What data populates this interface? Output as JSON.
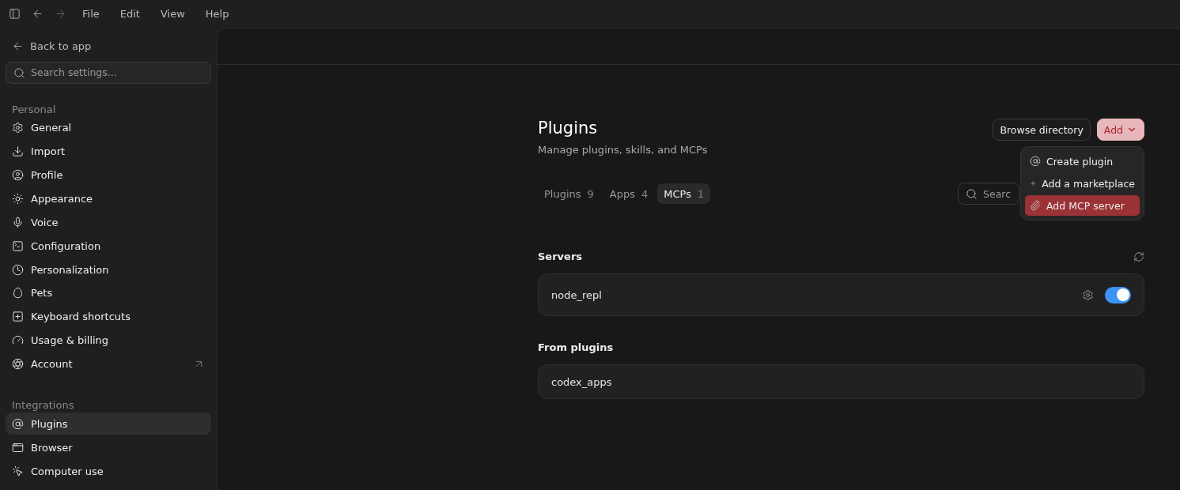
{
  "menu_bar": {
    "items": [
      "File",
      "Edit",
      "View",
      "Help"
    ]
  },
  "sidebar": {
    "back": "Back to app",
    "search": {
      "placeholder": "Search settings..."
    },
    "sections": [
      {
        "title": "Personal",
        "items": [
          {
            "label": "General",
            "selected": false,
            "external": false
          },
          {
            "label": "Import",
            "selected": false,
            "external": false
          },
          {
            "label": "Profile",
            "selected": false,
            "external": false
          },
          {
            "label": "Appearance",
            "selected": false,
            "external": false
          },
          {
            "label": "Voice",
            "selected": false,
            "external": false
          },
          {
            "label": "Configuration",
            "selected": false,
            "external": false
          },
          {
            "label": "Personalization",
            "selected": false,
            "external": false
          },
          {
            "label": "Pets",
            "selected": false,
            "external": false
          },
          {
            "label": "Keyboard shortcuts",
            "selected": false,
            "external": false
          },
          {
            "label": "Usage & billing",
            "selected": false,
            "external": false
          },
          {
            "label": "Account",
            "selected": false,
            "external": true
          }
        ]
      },
      {
        "title": "Integrations",
        "items": [
          {
            "label": "Plugins",
            "selected": true,
            "external": false
          },
          {
            "label": "Browser",
            "selected": false,
            "external": false
          },
          {
            "label": "Computer use",
            "selected": false,
            "external": false
          }
        ]
      }
    ]
  },
  "page": {
    "title": "Plugins",
    "subtitle": "Manage plugins, skills, and MCPs",
    "buttons": {
      "browse": "Browse directory",
      "add": "Add"
    },
    "add_menu": {
      "open": true,
      "items": [
        {
          "label": "Create plugin",
          "selected": false
        },
        {
          "label": "Add a marketplace",
          "selected": false
        },
        {
          "label": "Add MCP server",
          "selected": true
        }
      ]
    },
    "tabs": [
      {
        "label": "Plugins",
        "count": "9",
        "selected": false
      },
      {
        "label": "Apps",
        "count": "4",
        "selected": false
      },
      {
        "label": "MCPs",
        "count": "1",
        "selected": true
      }
    ],
    "search": {
      "placeholder": "Searc"
    },
    "servers": {
      "title": "Servers",
      "items": [
        {
          "name": "node_repl",
          "on": true
        }
      ]
    },
    "from_plugins": {
      "title": "From plugins",
      "items": [
        {
          "name": "codex_apps"
        }
      ]
    }
  }
}
